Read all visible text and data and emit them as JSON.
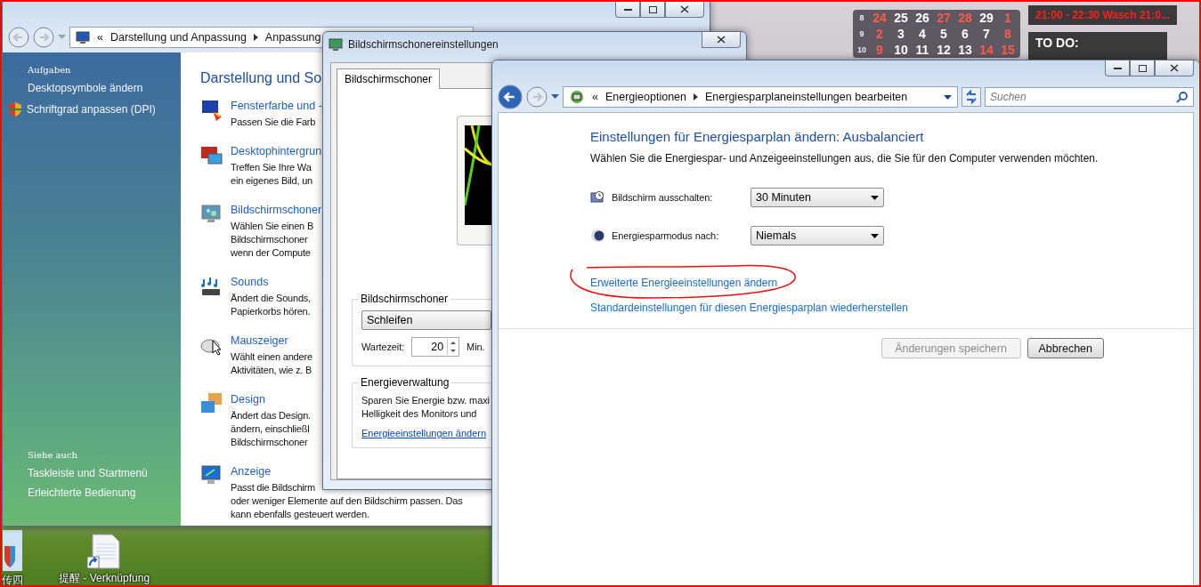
{
  "control_panel": {
    "breadcrumb": {
      "overflow": "«",
      "items": [
        "Darstellung und Anpassung",
        "Anpassung"
      ]
    },
    "sidebar": {
      "tasks_heading": "Aufgaben",
      "tasks": [
        {
          "label": "Desktopsymbole ändern",
          "shield": false
        },
        {
          "label": "Schriftgrad anpassen (DPI)",
          "shield": true
        }
      ],
      "see_also_heading": "Siehe auch",
      "see_also": [
        "Taskleiste und Startmenü",
        "Erleichterte Bedienung"
      ]
    },
    "heading": "Darstellung und So",
    "items": [
      {
        "kind": "colors",
        "title": "Fensterfarbe und -",
        "lines": [
          "Passen Sie die Farb"
        ]
      },
      {
        "kind": "wallpaper",
        "title": "Desktophintergrun",
        "lines": [
          "Treffen Sie Ihre Wa",
          "ein eigenes Bild, un"
        ]
      },
      {
        "kind": "screensaver",
        "title": "Bildschirmschoner",
        "lines": [
          "Wählen Sie einen B",
          "Bildschirmschoner",
          "wenn der Compute"
        ]
      },
      {
        "kind": "sounds",
        "title": "Sounds",
        "lines": [
          "Ändert die Sounds,",
          "Papierkorbs hören."
        ]
      },
      {
        "kind": "mouse",
        "title": "Mauszeiger",
        "lines": [
          "Wählt einen andere",
          "Aktivitäten, wie z. B"
        ]
      },
      {
        "kind": "theme",
        "title": "Design",
        "lines": [
          "Ändert das Design.",
          "ändern, einschließl",
          "Bildschirmschoner"
        ]
      },
      {
        "kind": "display",
        "title": "Anzeige",
        "lines": [
          "Passt die Bildschirm",
          "oder weniger Elemente auf den Bildschirm passen. Das",
          "kann ebenfalls gesteuert werden."
        ]
      }
    ]
  },
  "screensaver_dialog": {
    "title": "Bildschirmschonereinstellungen",
    "tab": {
      "label": "Bildschirmschoner",
      "selected": true
    },
    "group_title": "Bildschirmschoner",
    "selection": "Schleifen",
    "wait_label": "Wartezeit:",
    "wait_value": "20",
    "wait_unit": "Min.",
    "power_group_title": "Energieverwaltung",
    "power_lines": [
      "Sparen Sie Energie bzw. maxi",
      "Helligkeit des Monitors und"
    ],
    "power_link": "Energieeinstellungen ändern"
  },
  "power_window": {
    "breadcrumb": {
      "overflow": "«",
      "items": [
        "Energieoptionen",
        "Energiesparplaneinstellungen bearbeiten"
      ]
    },
    "search": {
      "placeholder": "Suchen"
    },
    "heading": "Einstellungen für Energiesparplan ändern: Ausbalanciert",
    "description": "Wählen Sie die Energiespar- und Anzeigeeinstellungen aus, die Sie für den Computer verwenden möchten.",
    "settings": [
      {
        "kind": "display",
        "label": "Bildschirm ausschalten:",
        "value": "30 Minuten"
      },
      {
        "kind": "sleep",
        "label": "Energiesparmodus nach:",
        "value": "Niemals"
      }
    ],
    "links": [
      {
        "label": "Erweiterte Energieeinstellungen ändern",
        "circled": true
      },
      {
        "label": "Standardeinstellungen für diesen Energiesparplan wiederherstellen",
        "circled": false
      }
    ],
    "buttons": [
      {
        "label": "Änderungen speichern",
        "disabled": true
      },
      {
        "label": "Abbrechen",
        "disabled": false
      }
    ]
  },
  "calendar_gadget": {
    "weeks": [
      {
        "week": "8",
        "days": [
          {
            "day": "24",
            "marked": true
          },
          {
            "day": "25",
            "marked": false
          },
          {
            "day": "26",
            "marked": false
          },
          {
            "day": "27",
            "marked": true
          },
          {
            "day": "28",
            "marked": true
          },
          {
            "day": "29",
            "marked": false
          },
          {
            "day": "1",
            "marked": true
          }
        ]
      },
      {
        "week": "9",
        "days": [
          {
            "day": "2",
            "marked": true
          },
          {
            "day": "3",
            "marked": false
          },
          {
            "day": "4",
            "marked": false
          },
          {
            "day": "5",
            "marked": false
          },
          {
            "day": "6",
            "marked": false
          },
          {
            "day": "7",
            "marked": false
          },
          {
            "day": "8",
            "marked": true
          }
        ]
      },
      {
        "week": "10",
        "days": [
          {
            "day": "9",
            "marked": true
          },
          {
            "day": "10",
            "marked": false
          },
          {
            "day": "11",
            "marked": false
          },
          {
            "day": "12",
            "marked": false
          },
          {
            "day": "13",
            "marked": false
          },
          {
            "day": "14",
            "marked": true
          },
          {
            "day": "15",
            "marked": true
          }
        ]
      }
    ]
  },
  "notes_gadget": {
    "event": "21:00 - 22:30 Wasch 21:0...",
    "todo_heading": "TO DO:"
  },
  "desktop_icons": [
    {
      "kind": "app",
      "label": "传四"
    },
    {
      "kind": "shortcut",
      "label": "提醒 - Verknüpfung"
    }
  ]
}
